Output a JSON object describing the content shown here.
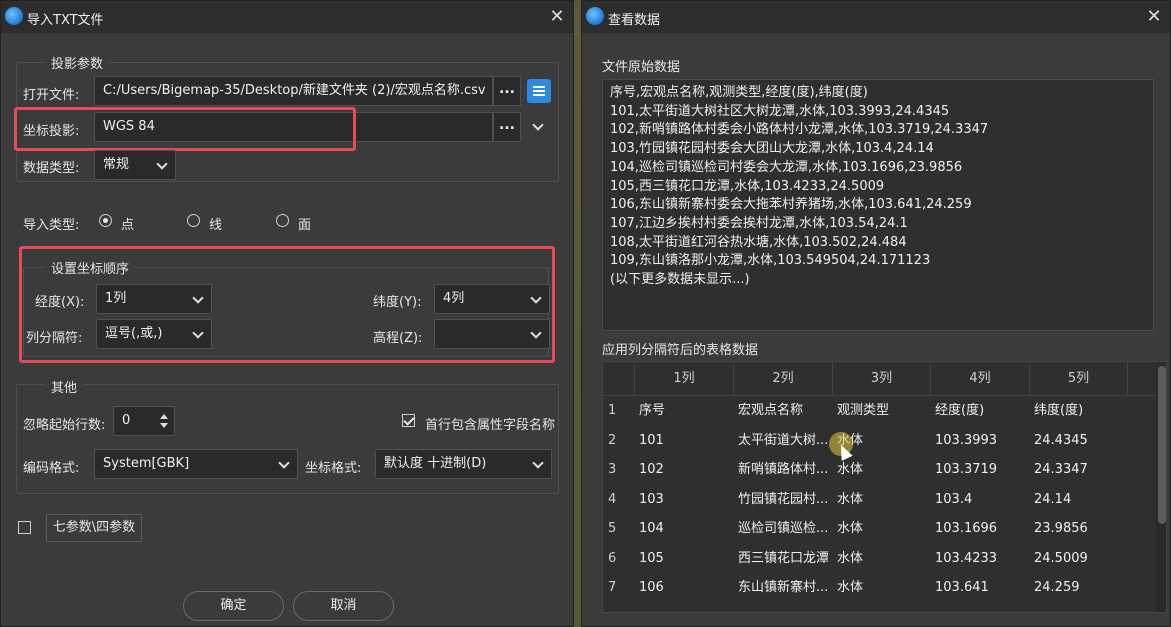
{
  "left_dialog": {
    "title": "导入TXT文件",
    "projection_group": {
      "title": "投影参数",
      "open_file_label": "打开文件:",
      "open_file_value": "C:/Users/Bigemap-35/Desktop/新建文件夹 (2)/宏观点名称.csv",
      "coord_proj_label": "坐标投影:",
      "coord_proj_value": "WGS 84",
      "data_type_label": "数据类型:",
      "data_type_value": "常规",
      "browse_label": "..."
    },
    "import_type": {
      "label": "导入类型:",
      "options": [
        "点",
        "线",
        "面"
      ],
      "selected": "点"
    },
    "coord_order_group": {
      "title": "设置坐标顺序",
      "lon_label": "经度(X):",
      "lon_value": "1列",
      "lat_label": "纬度(Y):",
      "lat_value": "4列",
      "sep_label": "列分隔符:",
      "sep_value": "逗号(,或,)",
      "elev_label": "高程(Z):",
      "elev_value": ""
    },
    "other_group": {
      "title": "其他",
      "skip_rows_label": "忽略起始行数:",
      "skip_rows_value": "0",
      "header_check_label": "首行包含属性字段名称",
      "header_checked": true,
      "encoding_label": "编码格式:",
      "encoding_value": "System[GBK]",
      "coord_format_label": "坐标格式:",
      "coord_format_value": "默认度 十进制(D)"
    },
    "seven_param_checked": false,
    "seven_param_label": "七参数\\四参数",
    "ok_label": "确定",
    "cancel_label": "取消"
  },
  "right_dialog": {
    "title": "查看数据",
    "raw_title": "文件原始数据",
    "raw_lines": [
      "序号,宏观点名称,观测类型,经度(度),纬度(度)",
      "101,太平街道大树社区大树龙潭,水体,103.3993,24.4345",
      "102,新哨镇路体村委会小路体村小龙潭,水体,103.3719,24.3347",
      "103,竹园镇花园村委会大团山大龙潭,水体,103.4,24.14",
      "104,巡检司镇巡检司村委会大龙潭,水体,103.1696,23.9856",
      "105,西三镇花口龙潭,水体,103.4233,24.5009",
      "106,东山镇新寨村委会大拖苯村养猪场,水体,103.641,24.259",
      "107,江边乡挨村村委会挨村龙潭,水体,103.54,24.1",
      "108,太平街道红河谷热水塘,水体,103.502,24.484",
      "109,东山镇洛那小龙潭,水体,103.549504,24.171123",
      "(以下更多数据未显示...)"
    ],
    "table_title": "应用列分隔符后的表格数据",
    "table_headers": [
      "1列",
      "2列",
      "3列",
      "4列",
      "5列"
    ],
    "table_rows": [
      {
        "n": "1",
        "c": [
          "序号",
          "宏观点名称",
          "观测类型",
          "经度(度)",
          "纬度(度)"
        ]
      },
      {
        "n": "2",
        "c": [
          "101",
          "太平街道大树...",
          "水体",
          "103.3993",
          "24.4345"
        ]
      },
      {
        "n": "3",
        "c": [
          "102",
          "新哨镇路体村...",
          "水体",
          "103.3719",
          "24.3347"
        ]
      },
      {
        "n": "4",
        "c": [
          "103",
          "竹园镇花园村...",
          "水体",
          "103.4",
          "24.14"
        ]
      },
      {
        "n": "5",
        "c": [
          "104",
          "巡检司镇巡检...",
          "水体",
          "103.1696",
          "23.9856"
        ]
      },
      {
        "n": "6",
        "c": [
          "105",
          "西三镇花口龙潭",
          "水体",
          "103.4233",
          "24.5009"
        ]
      },
      {
        "n": "7",
        "c": [
          "106",
          "东山镇新寨村...",
          "水体",
          "103.641",
          "24.259"
        ]
      }
    ]
  },
  "colors": {
    "highlight": "#e84a5a",
    "dialog_bg": "#3b3b3b",
    "titlebar_bg": "#2d2d2d",
    "accent": "#2c8ae0"
  }
}
